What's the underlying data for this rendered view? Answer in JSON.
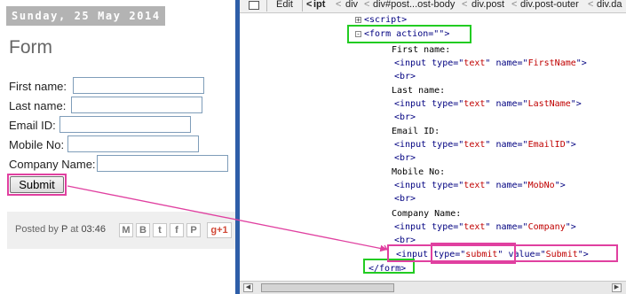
{
  "blog": {
    "date": "Sunday, 25 May 2014",
    "post_title": "Form",
    "fields": [
      {
        "label": "First name:",
        "value": ""
      },
      {
        "label": "Last name:",
        "value": ""
      },
      {
        "label": "Email ID:",
        "value": ""
      },
      {
        "label": "Mobile No:",
        "value": ""
      },
      {
        "label": "Company Name:",
        "value": ""
      }
    ],
    "submit_label": "Submit",
    "footer": {
      "posted_by_prefix": "Posted by",
      "author": "P",
      "at": "at",
      "time": "03:46",
      "share_icons": [
        "email-icon",
        "blogger-icon",
        "twitter-icon",
        "facebook-icon",
        "pinterest-icon"
      ],
      "share_glyphs": [
        "M",
        "B",
        "t",
        "f",
        "P"
      ],
      "gplus_label": "g+1"
    }
  },
  "devtools": {
    "toolbar": {
      "edit_label": "Edit",
      "breadcrumbs": [
        "ipt",
        "div",
        "div#post...ost-body",
        "div.post",
        "div.post-outer",
        "div.da"
      ],
      "breadcrumb_separator": "<"
    },
    "code_lines": [
      {
        "toggle": "+",
        "tokens": [
          {
            "t": "tag",
            "v": "<script>"
          }
        ]
      },
      {
        "toggle": "-",
        "tokens": [
          {
            "t": "tag",
            "v": "<form "
          },
          {
            "t": "attr",
            "v": "action"
          },
          {
            "t": "tag",
            "v": "=\""
          },
          {
            "t": "val",
            "v": ""
          },
          {
            "t": "tag",
            "v": "\">"
          }
        ]
      },
      {
        "tokens": [
          {
            "t": "txt",
            "v": "First name:"
          }
        ]
      },
      {
        "tokens": [
          {
            "t": "tag",
            "v": "<input "
          },
          {
            "t": "attr",
            "v": "type"
          },
          {
            "t": "tag",
            "v": "=\""
          },
          {
            "t": "val",
            "v": "text"
          },
          {
            "t": "tag",
            "v": "\" "
          },
          {
            "t": "attr",
            "v": "name"
          },
          {
            "t": "tag",
            "v": "=\""
          },
          {
            "t": "val",
            "v": "FirstName"
          },
          {
            "t": "tag",
            "v": "\">"
          }
        ]
      },
      {
        "tokens": [
          {
            "t": "tag",
            "v": "<br>"
          }
        ]
      },
      {
        "tokens": [
          {
            "t": "txt",
            "v": "Last name:"
          }
        ]
      },
      {
        "tokens": [
          {
            "t": "tag",
            "v": "<input "
          },
          {
            "t": "attr",
            "v": "type"
          },
          {
            "t": "tag",
            "v": "=\""
          },
          {
            "t": "val",
            "v": "text"
          },
          {
            "t": "tag",
            "v": "\" "
          },
          {
            "t": "attr",
            "v": "name"
          },
          {
            "t": "tag",
            "v": "=\""
          },
          {
            "t": "val",
            "v": "LastName"
          },
          {
            "t": "tag",
            "v": "\">"
          }
        ]
      },
      {
        "tokens": [
          {
            "t": "tag",
            "v": "<br>"
          }
        ]
      },
      {
        "tokens": [
          {
            "t": "txt",
            "v": "Email ID:"
          }
        ]
      },
      {
        "tokens": [
          {
            "t": "tag",
            "v": "<input "
          },
          {
            "t": "attr",
            "v": "type"
          },
          {
            "t": "tag",
            "v": "=\""
          },
          {
            "t": "val",
            "v": "text"
          },
          {
            "t": "tag",
            "v": "\" "
          },
          {
            "t": "attr",
            "v": "name"
          },
          {
            "t": "tag",
            "v": "=\""
          },
          {
            "t": "val",
            "v": "EmailID"
          },
          {
            "t": "tag",
            "v": "\">"
          }
        ]
      },
      {
        "tokens": [
          {
            "t": "tag",
            "v": "<br>"
          }
        ]
      },
      {
        "tokens": [
          {
            "t": "txt",
            "v": "Mobile No:"
          }
        ]
      },
      {
        "tokens": [
          {
            "t": "tag",
            "v": "<input "
          },
          {
            "t": "attr",
            "v": "type"
          },
          {
            "t": "tag",
            "v": "=\""
          },
          {
            "t": "val",
            "v": "text"
          },
          {
            "t": "tag",
            "v": "\" "
          },
          {
            "t": "attr",
            "v": "name"
          },
          {
            "t": "tag",
            "v": "=\""
          },
          {
            "t": "val",
            "v": "MobNo"
          },
          {
            "t": "tag",
            "v": "\">"
          }
        ]
      },
      {
        "tokens": [
          {
            "t": "tag",
            "v": "<br>"
          }
        ]
      },
      {
        "tokens": [
          {
            "t": "txt",
            "v": "Company Name:"
          }
        ]
      },
      {
        "tokens": [
          {
            "t": "tag",
            "v": "<input "
          },
          {
            "t": "attr",
            "v": "type"
          },
          {
            "t": "tag",
            "v": "=\""
          },
          {
            "t": "val",
            "v": "text"
          },
          {
            "t": "tag",
            "v": "\" "
          },
          {
            "t": "attr",
            "v": "name"
          },
          {
            "t": "tag",
            "v": "=\""
          },
          {
            "t": "val",
            "v": "Company"
          },
          {
            "t": "tag",
            "v": "\">"
          }
        ]
      },
      {
        "tokens": [
          {
            "t": "tag",
            "v": "<br>"
          }
        ]
      },
      {
        "tokens": [
          {
            "t": "tag",
            "v": "<input "
          },
          {
            "t": "attr",
            "v": "type"
          },
          {
            "t": "tag",
            "v": "=\""
          },
          {
            "t": "val",
            "v": "submit"
          },
          {
            "t": "tag",
            "v": "\" "
          },
          {
            "t": "attr",
            "v": "value"
          },
          {
            "t": "tag",
            "v": "=\""
          },
          {
            "t": "val",
            "v": "Submit"
          },
          {
            "t": "tag",
            "v": "\">"
          }
        ]
      },
      {
        "tokens": [
          {
            "t": "tag",
            "v": "</form>"
          }
        ]
      }
    ]
  },
  "colors": {
    "annotation_green": "#22cc22",
    "annotation_pink": "#e040a0",
    "devtools_tag": "#000080",
    "devtools_value": "#c00000",
    "date_bar": "#b3b3b3"
  }
}
